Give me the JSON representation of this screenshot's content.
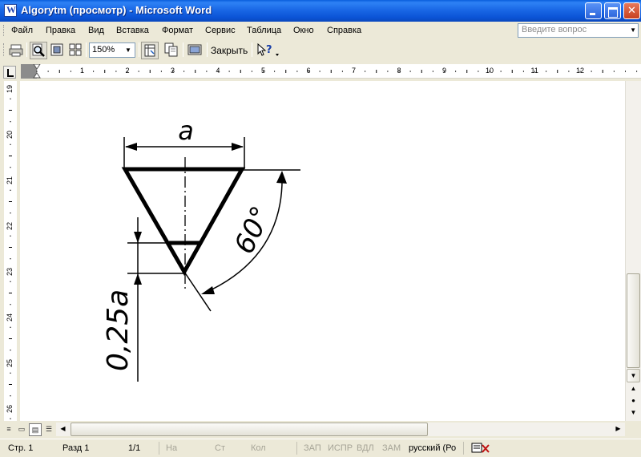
{
  "window": {
    "title": "Algorytm (просмотр) - Microsoft Word"
  },
  "menu": {
    "items": [
      "Файл",
      "Правка",
      "Вид",
      "Вставка",
      "Формат",
      "Сервис",
      "Таблица",
      "Окно",
      "Справка"
    ],
    "ask_placeholder": "Введите вопрос"
  },
  "toolbar": {
    "zoom": "150%",
    "close_label": "Закрыть"
  },
  "ruler": {
    "horizontal": [
      "1",
      "2",
      "3",
      "4",
      "5",
      "6",
      "7",
      "8",
      "9",
      "10",
      "11",
      "12"
    ],
    "vertical": [
      "19",
      "20",
      "21",
      "22",
      "23",
      "24",
      "25",
      "26"
    ]
  },
  "drawing": {
    "label_a": "a",
    "label_angle": "60°",
    "label_height": "0,25a"
  },
  "status": {
    "page": "Стр. 1",
    "section": "Разд 1",
    "pages": "1/1",
    "at": "На",
    "line": "Ст",
    "col": "Кол",
    "rec": "ЗАП",
    "trk": "ИСПР",
    "ext": "ВДЛ",
    "ovr": "ЗАМ",
    "language": "русский (Ро"
  },
  "colors": {
    "titlebar": "#0A5FDC",
    "chrome": "#ECE9D8",
    "close_button": "#C7401F"
  }
}
